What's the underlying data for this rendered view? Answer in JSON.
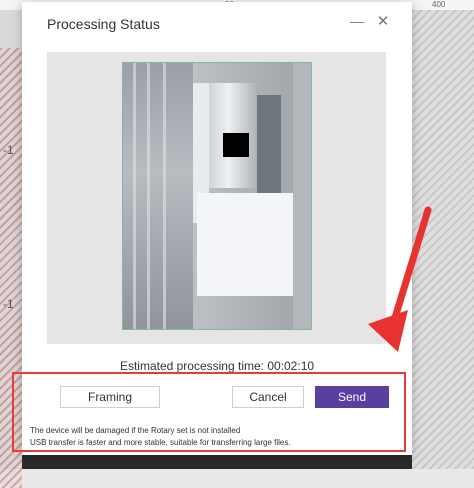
{
  "background": {
    "ruler_ticks": [
      "00",
      "400"
    ],
    "left_labels": [
      "-1",
      "-1"
    ]
  },
  "dialog": {
    "title": "Processing Status",
    "minimize_icon": "minimize-icon",
    "close_icon": "close-icon",
    "estimated_time_label": "Estimated processing time: 00:02:10",
    "buttons": {
      "framing": "Framing",
      "cancel": "Cancel",
      "send": "Send"
    },
    "notes": [
      "The device will be damaged if the Rotary set is not installed",
      "USB transfer is faster and more stable, suitable for transferring large files."
    ]
  },
  "colors": {
    "send_button": "#5b3fa0",
    "highlight_box": "#e23c3c",
    "arrow": "#e8322f"
  }
}
